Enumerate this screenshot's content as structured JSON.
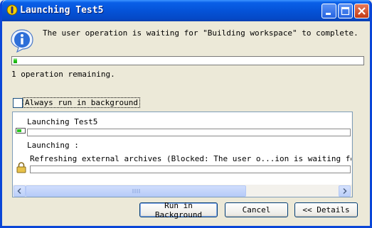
{
  "window": {
    "title": "Launching Test5"
  },
  "message": {
    "text": "The user operation is waiting for \"Building workspace\" to complete."
  },
  "progress": {
    "fraction": 0.01
  },
  "remaining": {
    "text": "1 operation remaining."
  },
  "background_option": {
    "label": "Always run in background",
    "checked": false
  },
  "details": {
    "job1": {
      "name": "Launching Test5",
      "status": "Launching :"
    },
    "job2": {
      "name": "Refreshing external archives (Blocked: The user o...ion is waiting for back"
    }
  },
  "buttons": {
    "run_in_background": "Run in Background",
    "cancel": "Cancel",
    "details": "<< Details"
  },
  "colors": {
    "titlebar": "#0553d8",
    "progress_fill": "#27c51c",
    "frame": "#0a46d7"
  }
}
